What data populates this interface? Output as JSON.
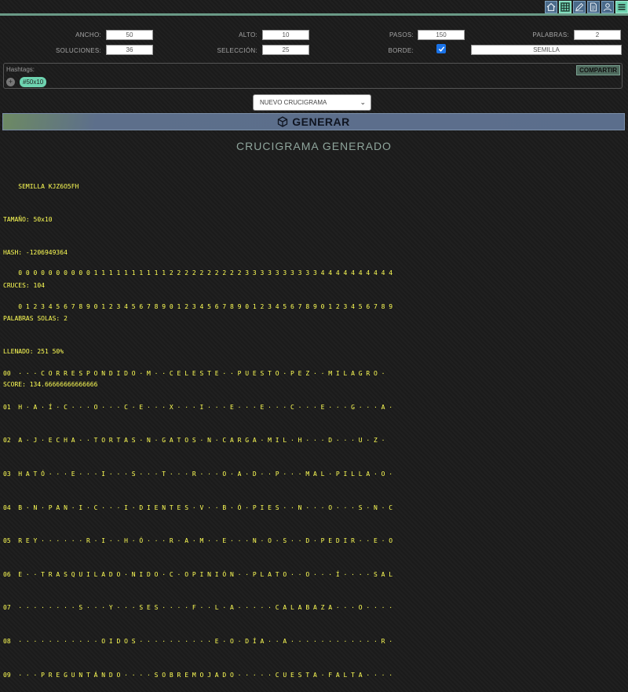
{
  "toolbar": {
    "icons": [
      "home-icon",
      "grid-icon",
      "edit-icon",
      "document-icon",
      "user-icon",
      "menu-icon"
    ]
  },
  "form": {
    "ancho_label": "ANCHO:",
    "ancho_value": "50",
    "alto_label": "ALTO:",
    "alto_value": "10",
    "pasos_label": "PASOS:",
    "pasos_value": "150",
    "palabras_label": "PALABRAS:",
    "palabras_value": "2",
    "soluciones_label": "SOLUCIONES:",
    "soluciones_value": "36",
    "seleccion_label": "SELECCIÓN:",
    "seleccion_value": "25",
    "borde_label": "BORDE:",
    "borde_checked": true,
    "semilla_value": "SEMILLA"
  },
  "hashtags": {
    "label": "Hashtags:",
    "share_label": "COMPARTIR",
    "add_label": "+",
    "tags": [
      "#50x10"
    ]
  },
  "select": {
    "value": "NUEVO CRUCIGRAMA"
  },
  "generate": {
    "label": "GENERAR"
  },
  "result": {
    "title": "CRUCIGRAMA GENERADO",
    "info": [
      "    SEMILLA KJZ6O5FH",
      "TAMAÑO: 50x10",
      "HASH: -1206949364",
      "CRUCES: 104",
      "PALABRAS SOLAS: 2",
      "LLENADO: 251 50%",
      "SCORE: 134.66666666666666"
    ],
    "grid": [
      "    0 0 0 0 0 0 0 0 0 0 1 1 1 1 1 1 1 1 1 1 2 2 2 2 2 2 2 2 2 2 3 3 3 3 3 3 3 3 3 3 4 4 4 4 4 4 4 4 4 4",
      "    0 1 2 3 4 5 6 7 8 9 0 1 2 3 4 5 6 7 8 9 0 1 2 3 4 5 6 7 8 9 0 1 2 3 4 5 6 7 8 9 0 1 2 3 4 5 6 7 8 9",
      "",
      "00  · · · C O R R E S P O N D I D O · M · · C E L E S T E · · P U E S T O · P E Z · · M I L A G R O ·",
      "01  H · A · Í · C · · · O · · · C · E · · · X · · · I · · · E · · · E · · · C · · · E · · · G · · · A ·",
      "02  A · J · E C H A · · T O R T A S · N · G A T O S · N · C A R G A · M I L · H · · · D · · · U · Z ·",
      "03  H A T Ó · · · E · · · I · · · S · · · T · · · R · · · O · A · D · · P · · · M A L · P I L L A · O ·",
      "04  B · N · P A N · I · C · · · I · D I E N T E S · V · · B · Ó · P I E S · · N · · · O · · · S · N · C",
      "05  R E Y · · · · · · R · I · · H · Ó · · · R · A · M · · E · · · N · O · S · · D · P E D I R · · E · O",
      "06  E · · T R A S Q U I L A D O · N I D O · C · O P I N I Ó N · · P L A T O · · O · · · Í · · · · S A L",
      "07  · · · · · · · · S · · · Y · · · S E S · · · · F · · L · A · · · · · C A L A B A Z A · · · O · · · ·",
      "08  · · · · · · · · · · · O I D O S · · · · · · · · · · E · O · D Í A · · A · · · · · · · · · · · · R ·",
      "09  · · · P R E G U N T Á N D O · · · · S O B R E M O J A D O · · · · · C U E S T A · F A L T A · · · ·"
    ]
  }
}
